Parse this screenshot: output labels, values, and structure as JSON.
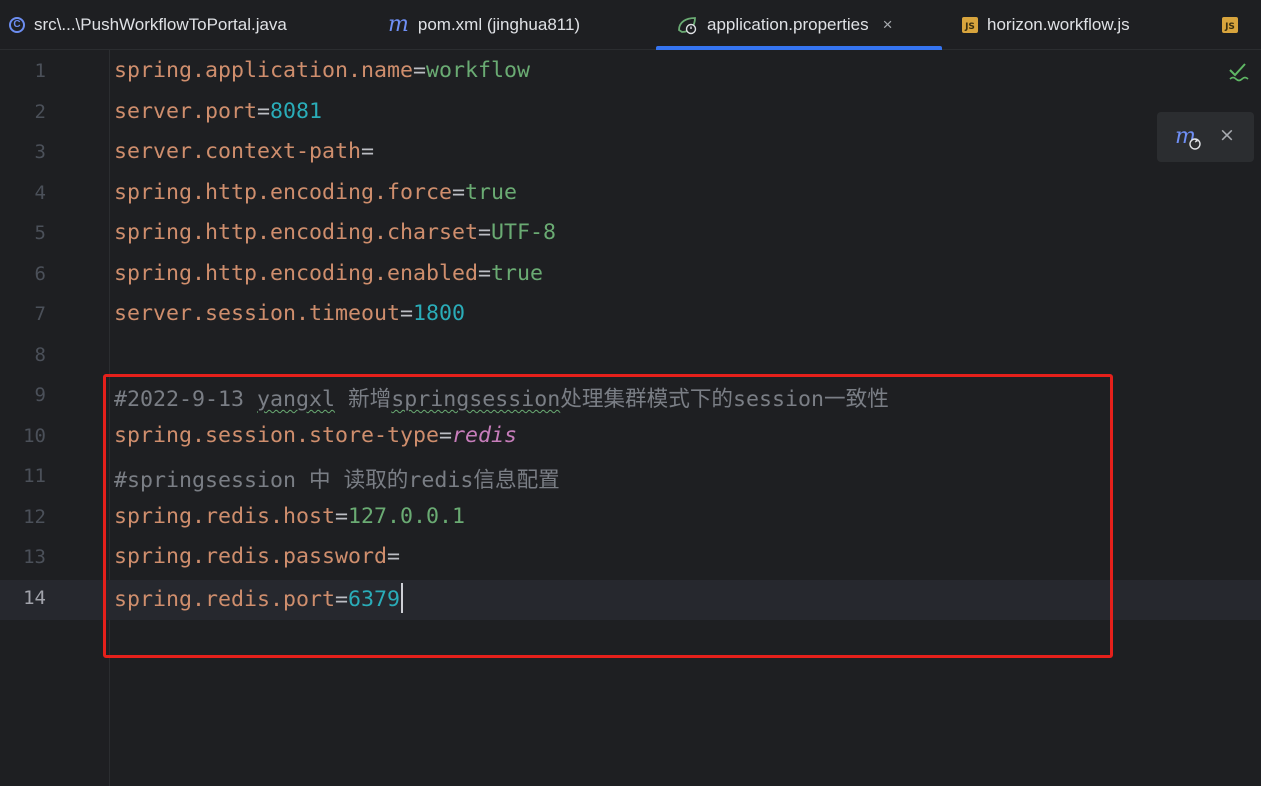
{
  "tabs": [
    {
      "label": "src\\...\\PushWorkflowToPortal.java",
      "icon": "java-class-icon"
    },
    {
      "label": "pom.xml (jinghua811)",
      "icon": "maven-icon"
    },
    {
      "label": "application.properties",
      "icon": "spring-properties-icon",
      "active": true,
      "close": "×"
    },
    {
      "label": "horizon.workflow.js",
      "icon": "javascript-icon"
    }
  ],
  "js_badge": "JS",
  "class_badge": "C",
  "maven_popup": {
    "close": "×"
  },
  "editor": {
    "line_numbers": [
      "1",
      "2",
      "3",
      "4",
      "5",
      "6",
      "7",
      "8",
      "9",
      "10",
      "11",
      "12",
      "13",
      "14"
    ],
    "current_line": 14,
    "lines": [
      {
        "key": "spring.application.name",
        "eq": "=",
        "value": "workflow",
        "kind": "string"
      },
      {
        "key": "server.port",
        "eq": "=",
        "value": "8081",
        "kind": "number"
      },
      {
        "key": "server.context-path",
        "eq": "=",
        "value": "",
        "kind": "string"
      },
      {
        "key": "spring.http.encoding.force",
        "eq": "=",
        "value": "true",
        "kind": "string"
      },
      {
        "key": "spring.http.encoding.charset",
        "eq": "=",
        "value": "UTF-8",
        "kind": "string"
      },
      {
        "key": "spring.http.encoding.enabled",
        "eq": "=",
        "value": "true",
        "kind": "string"
      },
      {
        "key": "server.session.timeout",
        "eq": "=",
        "value": "1800",
        "kind": "number"
      },
      {
        "empty": true
      },
      {
        "comment_parts": [
          "#2022-9-13 ",
          "yangxl",
          " 新增",
          "springsession",
          "处理集群模式下的session一致性"
        ]
      },
      {
        "key": "spring.session.store-type",
        "eq": "=",
        "value": "redis",
        "kind": "italic"
      },
      {
        "comment": "#springsession 中 读取的redis信息配置"
      },
      {
        "key": "spring.redis.host",
        "eq": "=",
        "value": "127.0.0.1",
        "kind": "string"
      },
      {
        "key": "spring.redis.password",
        "eq": "=",
        "value": "",
        "kind": "string"
      },
      {
        "key": "spring.redis.port",
        "eq": "=",
        "value": "6379",
        "kind": "number"
      }
    ]
  },
  "colors": {
    "background": "#1e1f22",
    "key": "#cf8e6d",
    "string_value": "#6aab73",
    "number_value": "#2aacb8",
    "comment": "#7a7e85",
    "active_tab_underline": "#3574f0",
    "highlight_box": "#e5201b"
  }
}
